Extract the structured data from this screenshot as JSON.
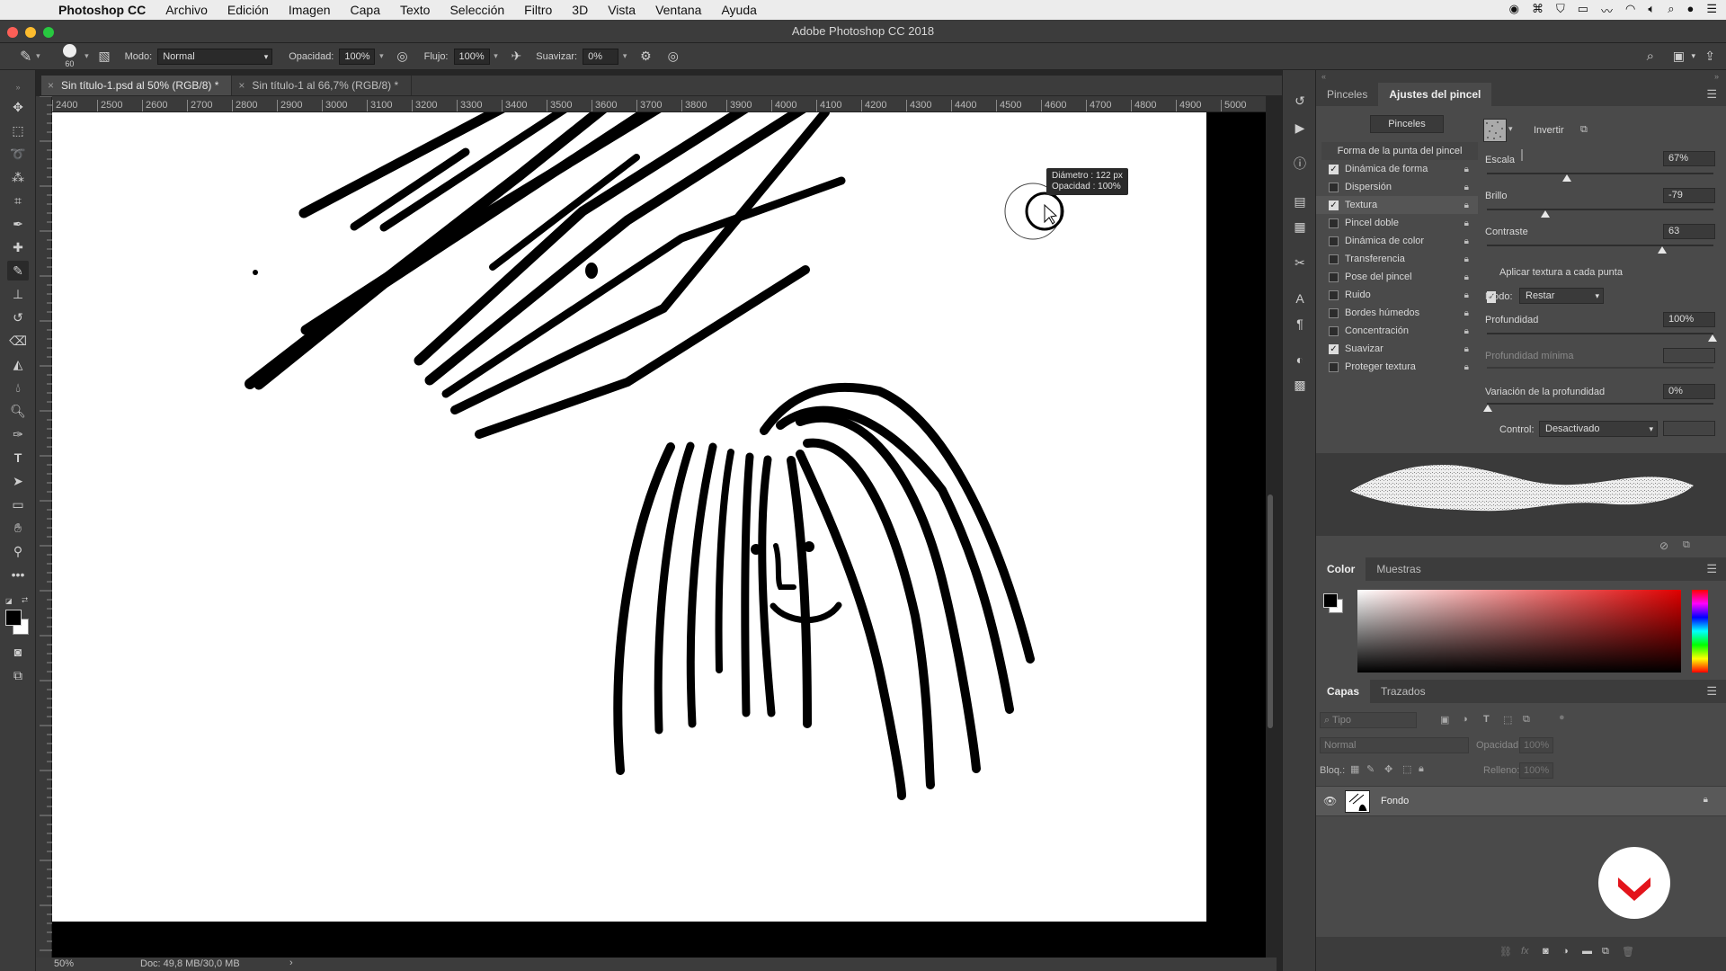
{
  "menubar": {
    "app": "Photoshop CC",
    "items": [
      "Archivo",
      "Edición",
      "Imagen",
      "Capa",
      "Texto",
      "Selección",
      "Filtro",
      "3D",
      "Vista",
      "Ventana",
      "Ayuda"
    ]
  },
  "window": {
    "title": "Adobe Photoshop CC 2018"
  },
  "options": {
    "brush_size": "60",
    "mode_label": "Modo:",
    "mode_value": "Normal",
    "opacity_label": "Opacidad:",
    "opacity_value": "100%",
    "flow_label": "Flujo:",
    "flow_value": "100%",
    "smooth_label": "Suavizar:",
    "smooth_value": "0%"
  },
  "doc_tabs": [
    {
      "label": "Sin título-1.psd al 50% (RGB/8) *"
    },
    {
      "label": "Sin título-1 al 66,7% (RGB/8) *"
    }
  ],
  "ruler": {
    "h_ticks": [
      "2400",
      "2500",
      "2600",
      "2700",
      "2800",
      "2900",
      "3000",
      "3100",
      "3200",
      "3300",
      "3400",
      "3500",
      "3600",
      "3700",
      "3800",
      "3900",
      "4000",
      "4100",
      "4200",
      "4300",
      "4400",
      "4500",
      "4600",
      "4700",
      "4800",
      "4900",
      "5000"
    ]
  },
  "tooltip": {
    "line1": "Diámetro : 122 px",
    "line2": "Opacidad : 100%"
  },
  "status": {
    "zoom": "50%",
    "doc": "Doc: 49,8 MB/30,0 MB",
    "arrow": "›"
  },
  "brush_panel": {
    "tabs": [
      "Pinceles",
      "Ajustes del pincel"
    ],
    "presets_button": "Pinceles",
    "section_title": "Forma de la punta del pincel",
    "items": [
      {
        "label": "Dinámica de forma",
        "checked": true
      },
      {
        "label": "Dispersión",
        "checked": false
      },
      {
        "label": "Textura",
        "checked": true
      },
      {
        "label": "Pincel doble",
        "checked": false
      },
      {
        "label": "Dinámica de color",
        "checked": false
      },
      {
        "label": "Transferencia",
        "checked": false
      },
      {
        "label": "Pose del pincel",
        "checked": false
      },
      {
        "label": "Ruido",
        "checked": false
      },
      {
        "label": "Bordes húmedos",
        "checked": false
      },
      {
        "label": "Concentración",
        "checked": false
      },
      {
        "label": "Suavizar",
        "checked": true
      },
      {
        "label": "Proteger textura",
        "checked": false
      }
    ],
    "invert_label": "Invertir",
    "scale_label": "Escala",
    "scale_value": "67%",
    "scale_level": 0.67,
    "brightness_label": "Brillo",
    "brightness_value": "-79",
    "contrast_label": "Contraste",
    "contrast_value": "63",
    "apply_each_label": "Aplicar textura a cada punta",
    "mode_label": "Modo:",
    "mode_value": "Restar",
    "depth_label": "Profundidad",
    "depth_value": "100%",
    "depth_level": 1.0,
    "min_depth_label": "Profundidad mínima",
    "depth_jitter_label": "Variación de la profundidad",
    "depth_jitter_value": "0%",
    "depth_jitter_level": 0.0,
    "control_label": "Control:",
    "control_value": "Desactivado"
  },
  "color_panel": {
    "tabs": [
      "Color",
      "Muestras"
    ]
  },
  "layers_panel": {
    "tabs": [
      "Capas",
      "Trazados"
    ],
    "search_placeholder": "Tipo",
    "blend_mode": "Normal",
    "opacity_label": "Opacidad:",
    "opacity_value": "100%",
    "lock_label": "Bloq.:",
    "fill_label": "Relleno:",
    "fill_value": "100%",
    "layers": [
      {
        "name": "Fondo"
      }
    ]
  }
}
